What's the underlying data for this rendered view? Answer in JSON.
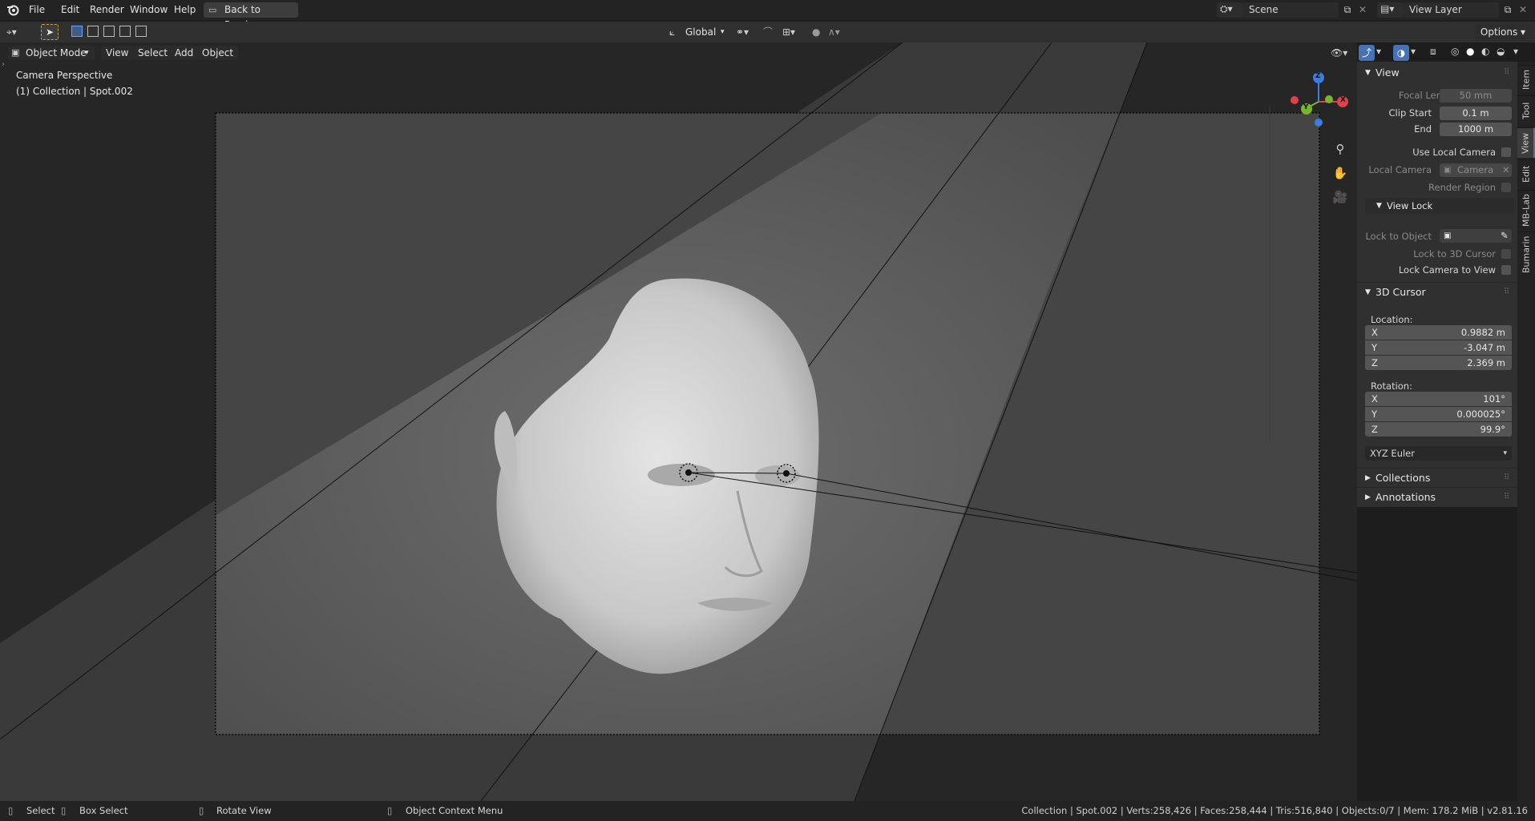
{
  "menu": {
    "file": "File",
    "edit": "Edit",
    "render": "Render",
    "window": "Window",
    "help": "Help",
    "back": "Back to Previous",
    "scene": "Scene",
    "view_layer": "View Layer"
  },
  "toolbar": {
    "orientation": "Global",
    "options": "Options"
  },
  "header3d": {
    "mode": "Object Mode",
    "view": "View",
    "select": "Select",
    "add": "Add",
    "object": "Object"
  },
  "viewport": {
    "title": "Camera Perspective",
    "subtitle": "(1) Collection | Spot.002",
    "axis_x": "X",
    "axis_y": "Y",
    "axis_z": "Z"
  },
  "tabs": [
    "Item",
    "Tool",
    "View",
    "Edit",
    "MB-Lab",
    "Bumarin"
  ],
  "view_panel": {
    "header": "View",
    "focal_length_label": "Focal Length",
    "focal_length": "50 mm",
    "clip_start_label": "Clip Start",
    "clip_start": "0.1 m",
    "end_label": "End",
    "end": "1000 m",
    "use_local_camera": "Use Local Camera",
    "local_camera_label": "Local Camera",
    "local_camera": "Camera",
    "render_region": "Render Region"
  },
  "view_lock": {
    "header": "View Lock",
    "lock_to_object": "Lock to Object",
    "lock_to_cursor": "Lock to 3D Cursor",
    "lock_camera": "Lock Camera to View"
  },
  "cursor_panel": {
    "header": "3D Cursor",
    "location_label": "Location:",
    "loc": [
      {
        "axis": "X",
        "value": "0.9882 m"
      },
      {
        "axis": "Y",
        "value": "-3.047 m"
      },
      {
        "axis": "Z",
        "value": "2.369 m"
      }
    ],
    "rotation_label": "Rotation:",
    "rot": [
      {
        "axis": "X",
        "value": "101°"
      },
      {
        "axis": "Y",
        "value": "0.000025°"
      },
      {
        "axis": "Z",
        "value": "99.9°"
      }
    ],
    "rotation_mode": "XYZ Euler"
  },
  "collections": "Collections",
  "annotations": "Annotations",
  "status": {
    "select": "Select",
    "box_select": "Box Select",
    "rotate_view": "Rotate View",
    "context_menu": "Object Context Menu",
    "info": "Collection | Spot.002 | Verts:258,426 | Faces:258,444 | Tris:516,840 | Objects:0/7 | Mem: 178.2 MiB | v2.81.16"
  }
}
